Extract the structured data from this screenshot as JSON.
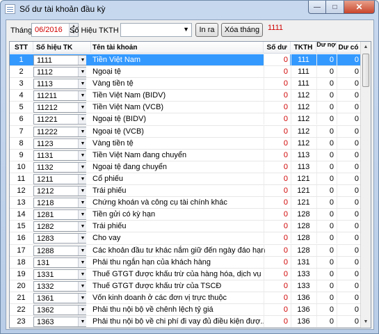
{
  "window": {
    "title": "Số dư tài khoản đầu kỳ"
  },
  "toolbar": {
    "month_label": "Tháng",
    "month_value": "06/2016",
    "account_label": "Số Hiệu TKTH",
    "account_value": "",
    "print_button": "In ra",
    "delete_button": "Xóa tháng",
    "account_counter": "1111"
  },
  "table": {
    "headers": {
      "stt": "STT",
      "code": "Số hiệu TK",
      "name": "Tên tài khoản",
      "balance": "Số dư",
      "tkth": "TKTH",
      "debit": "Dư nợ",
      "credit": "Dư có"
    },
    "selected_row": 0,
    "rows": [
      {
        "stt": "1",
        "code": "1111",
        "name": "Tiền Việt Nam",
        "balance": "0",
        "tkth": "111",
        "debit": "0",
        "credit": "0"
      },
      {
        "stt": "2",
        "code": "1112",
        "name": "Ngoại tệ",
        "balance": "0",
        "tkth": "111",
        "debit": "0",
        "credit": "0"
      },
      {
        "stt": "3",
        "code": "1113",
        "name": "Vàng tiền tệ",
        "balance": "0",
        "tkth": "111",
        "debit": "0",
        "credit": "0"
      },
      {
        "stt": "4",
        "code": "11211",
        "name": "Tiền Việt Nam (BIDV)",
        "balance": "0",
        "tkth": "112",
        "debit": "0",
        "credit": "0"
      },
      {
        "stt": "5",
        "code": "11212",
        "name": "Tiền Việt Nam (VCB)",
        "balance": "0",
        "tkth": "112",
        "debit": "0",
        "credit": "0"
      },
      {
        "stt": "6",
        "code": "11221",
        "name": "Ngoại tệ (BIDV)",
        "balance": "0",
        "tkth": "112",
        "debit": "0",
        "credit": "0"
      },
      {
        "stt": "7",
        "code": "11222",
        "name": "Ngoại tệ (VCB)",
        "balance": "0",
        "tkth": "112",
        "debit": "0",
        "credit": "0"
      },
      {
        "stt": "8",
        "code": "1123",
        "name": "Vàng tiền tệ",
        "balance": "0",
        "tkth": "112",
        "debit": "0",
        "credit": "0"
      },
      {
        "stt": "9",
        "code": "1131",
        "name": "Tiền Việt Nam đang chuyển",
        "balance": "0",
        "tkth": "113",
        "debit": "0",
        "credit": "0"
      },
      {
        "stt": "10",
        "code": "1132",
        "name": "Ngoại tệ đang chuyển",
        "balance": "0",
        "tkth": "113",
        "debit": "0",
        "credit": "0"
      },
      {
        "stt": "11",
        "code": "1211",
        "name": "Cổ phiếu",
        "balance": "0",
        "tkth": "121",
        "debit": "0",
        "credit": "0"
      },
      {
        "stt": "12",
        "code": "1212",
        "name": "Trái phiếu",
        "balance": "0",
        "tkth": "121",
        "debit": "0",
        "credit": "0"
      },
      {
        "stt": "13",
        "code": "1218",
        "name": "Chứng khoán và công cụ tài chính khác",
        "balance": "0",
        "tkth": "121",
        "debit": "0",
        "credit": "0"
      },
      {
        "stt": "14",
        "code": "1281",
        "name": "Tiền gửi có kỳ hạn",
        "balance": "0",
        "tkth": "128",
        "debit": "0",
        "credit": "0"
      },
      {
        "stt": "15",
        "code": "1282",
        "name": "Trái phiếu",
        "balance": "0",
        "tkth": "128",
        "debit": "0",
        "credit": "0"
      },
      {
        "stt": "16",
        "code": "1283",
        "name": "Cho vay",
        "balance": "0",
        "tkth": "128",
        "debit": "0",
        "credit": "0"
      },
      {
        "stt": "17",
        "code": "1288",
        "name": "Các khoản đầu tư khác nắm giữ đến ngày đáo hạn",
        "balance": "0",
        "tkth": "128",
        "debit": "0",
        "credit": "0"
      },
      {
        "stt": "18",
        "code": "131",
        "name": "Phải thu ngắn hạn của khách hàng",
        "balance": "0",
        "tkth": "131",
        "debit": "0",
        "credit": "0"
      },
      {
        "stt": "19",
        "code": "1331",
        "name": "Thuế GTGT được khấu trừ của hàng hóa, dịch vụ",
        "balance": "0",
        "tkth": "133",
        "debit": "0",
        "credit": "0"
      },
      {
        "stt": "20",
        "code": "1332",
        "name": "Thuế GTGT được khấu trừ của TSCĐ",
        "balance": "0",
        "tkth": "133",
        "debit": "0",
        "credit": "0"
      },
      {
        "stt": "21",
        "code": "1361",
        "name": "Vốn kinh doanh ở các đơn vị trực thuộc",
        "balance": "0",
        "tkth": "136",
        "debit": "0",
        "credit": "0"
      },
      {
        "stt": "22",
        "code": "1362",
        "name": "Phải thu nội bộ về chênh lệch tỷ giá",
        "balance": "0",
        "tkth": "136",
        "debit": "0",
        "credit": "0"
      },
      {
        "stt": "23",
        "code": "1363",
        "name": "Phải thu nội bộ về chi phí đi vay đủ điều kiện đượ...",
        "balance": "0",
        "tkth": "136",
        "debit": "0",
        "credit": "0"
      }
    ]
  },
  "colors": {
    "accent_red": "#d00000",
    "selection": "#3399ff"
  }
}
